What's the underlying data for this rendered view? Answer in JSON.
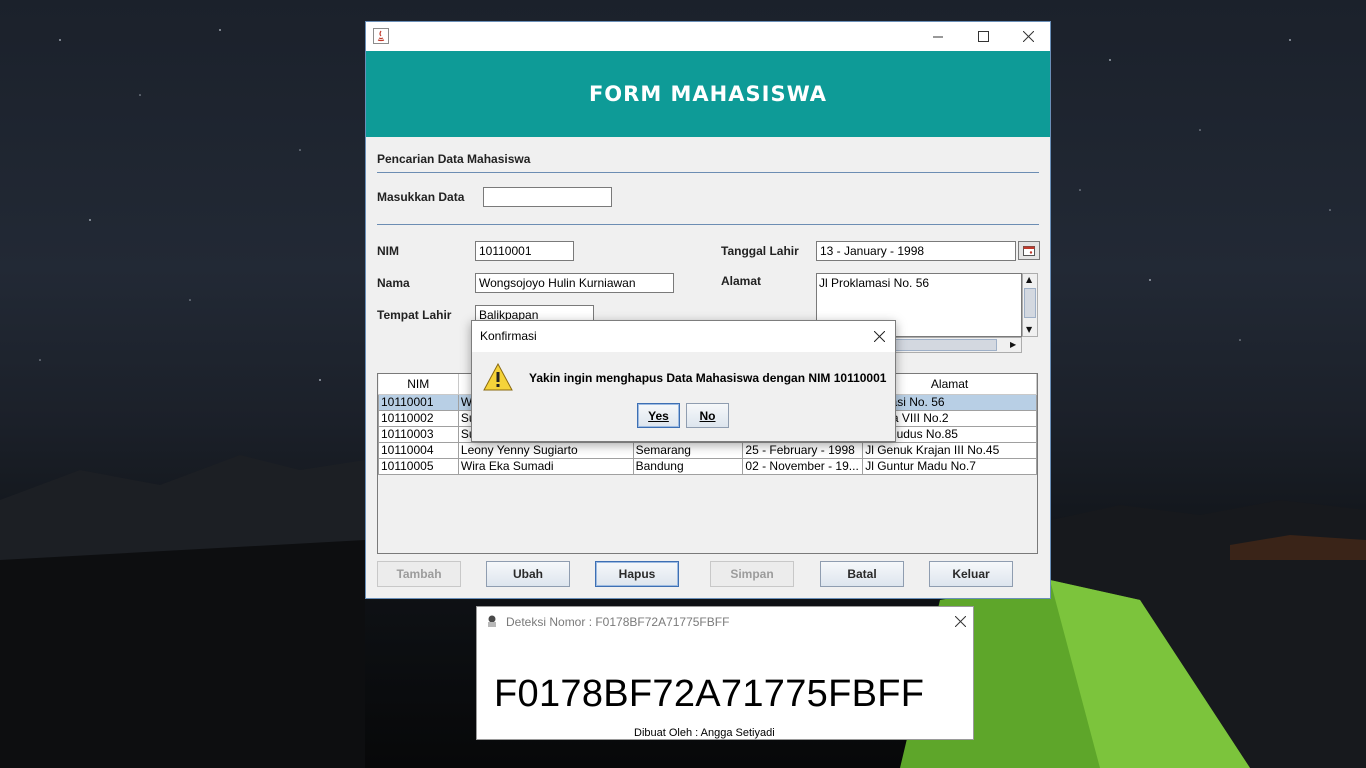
{
  "main_window": {
    "header_title": "FORM MAHASISWA",
    "search": {
      "section_title": "Pencarian Data Mahasiswa",
      "label": "Masukkan Data",
      "value": ""
    },
    "form": {
      "nim_label": "NIM",
      "nim_value": "10110001",
      "nama_label": "Nama",
      "nama_value": "Wongsojoyo Hulin Kurniawan",
      "tempat_label": "Tempat Lahir",
      "tempat_value": "Balikpapan",
      "tanggal_label": "Tanggal Lahir",
      "tanggal_value": "13 - January - 1998",
      "alamat_label": "Alamat",
      "alamat_value": "Jl Proklamasi No. 56"
    },
    "table": {
      "columns": [
        "NIM",
        "",
        "",
        "",
        "Alamat"
      ],
      "rows": [
        [
          "10110001",
          "We",
          "",
          "",
          "klamasi No. 56"
        ],
        [
          "10110002",
          "Su",
          "",
          "",
          "ndaria VIII No.2"
        ],
        [
          "10110003",
          "Su",
          "",
          "",
          "nan Kudus No.85"
        ],
        [
          "10110004",
          "Leony Yenny Sugiarto",
          "Semarang",
          "25 - February - 1998",
          "Jl Genuk Krajan III No.45"
        ],
        [
          "10110005",
          "Wira Eka Sumadi",
          "Bandung",
          "02 - November - 19...",
          "Jl Guntur Madu No.7"
        ]
      ],
      "selected_row": 0
    },
    "buttons": {
      "tambah": "Tambah",
      "ubah": "Ubah",
      "hapus": "Hapus",
      "simpan": "Simpan",
      "batal": "Batal",
      "keluar": "Keluar"
    }
  },
  "dialog": {
    "title": "Konfirmasi",
    "message": "Yakin ingin menghapus Data Mahasiswa dengan NIM 10110001",
    "yes": "Yes",
    "no": "No"
  },
  "detection": {
    "title": "Deteksi Nomor : F0178BF72A71775FBFF",
    "number": "F0178BF72A71775FBFF",
    "credit": "Dibuat Oleh : Angga Setiyadi"
  },
  "colors": {
    "header_teal": "#0e9b97",
    "selection": "#b8cfe5"
  }
}
